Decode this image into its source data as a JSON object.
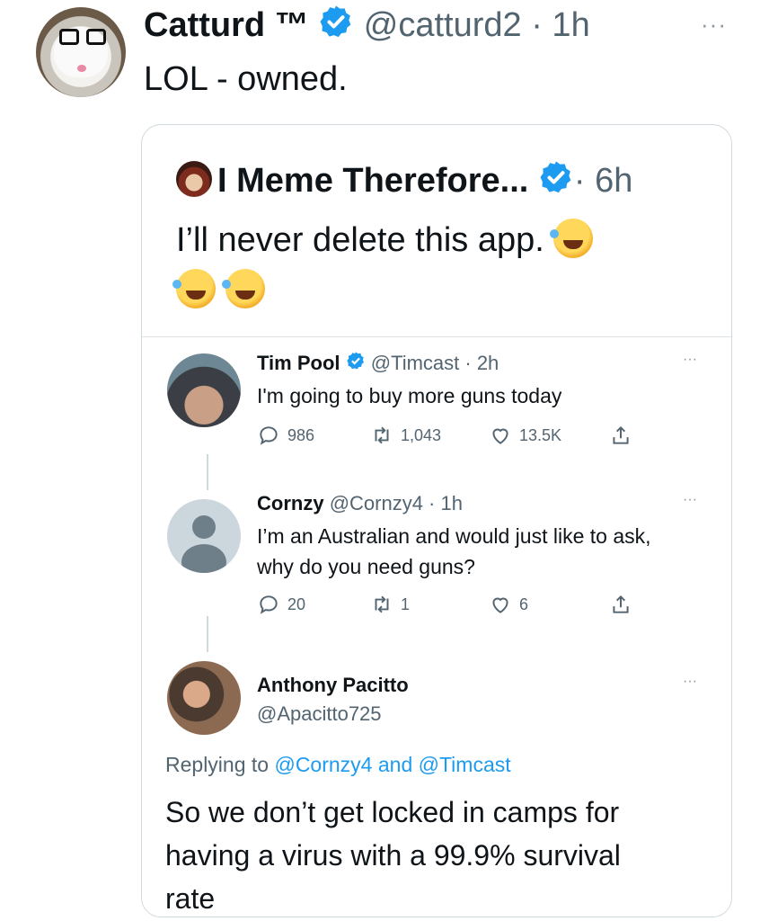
{
  "main_tweet": {
    "display_name": "Catturd ™",
    "handle_time": "@catturd2 · 1h",
    "more": "···",
    "text": "LOL - owned."
  },
  "quoted_tweet": {
    "display_name": "I Meme Therefore...",
    "time": "· 6h",
    "text": "I’ll never delete this app."
  },
  "screenshot": {
    "tweets": [
      {
        "name": "Tim Pool",
        "meta": "@Timcast · 2h",
        "text": "I'm going to buy more guns today",
        "replies": "986",
        "retweets": "1,043",
        "likes": "13.5K"
      },
      {
        "name": "Cornzy",
        "meta": "@Cornzy4 · 1h",
        "text_lines": [
          "I’m an Australian and would just like to ask,",
          "why do you need guns?"
        ],
        "replies": "20",
        "retweets": "1",
        "likes": "6"
      }
    ],
    "reply": {
      "name": "Anthony Pacitto",
      "handle": "@Apacitto725",
      "replying_prefix": "Replying to ",
      "replying_to_1": "@Cornzy4",
      "replying_and": " and ",
      "replying_to_2": "@Timcast",
      "text_lines": [
        "So we don’t get locked in camps for",
        "having a virus with a 99.9% survival",
        "rate"
      ]
    },
    "more": "···"
  },
  "colors": {
    "verified": "#1d9bf0",
    "text": "#0f1419",
    "secondary": "#536471",
    "link": "#1d9bf0",
    "border": "#cfd9de"
  }
}
